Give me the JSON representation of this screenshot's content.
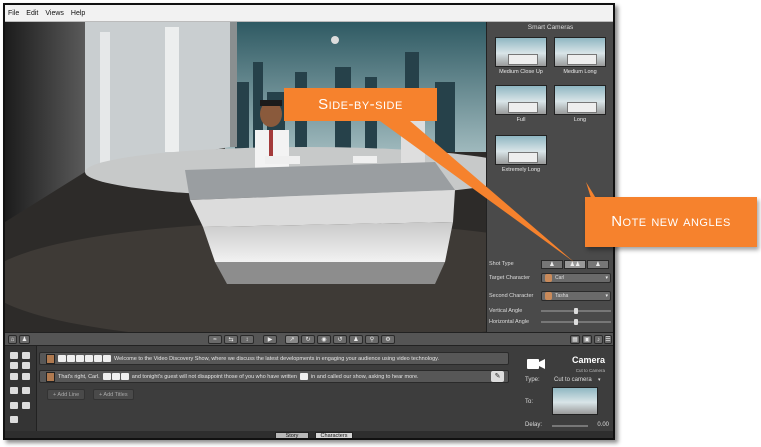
{
  "menu": [
    "File",
    "Edit",
    "Views",
    "Help"
  ],
  "side_panel": {
    "title": "Smart Cameras",
    "cameras": [
      {
        "label": "Medium Close Up"
      },
      {
        "label": "Medium Long"
      },
      {
        "label": "Full"
      },
      {
        "label": "Long"
      },
      {
        "label": "Extremely Long"
      }
    ],
    "shot_type_label": "Shot Type",
    "target_label": "Target Character",
    "target_value": "Carl",
    "second_label": "Second Character",
    "second_value": "Tasha",
    "vertical_angle_label": "Vertical Angle",
    "horizontal_angle_label": "Horizontal Angle",
    "vertical_angle_value": 0.5,
    "horizontal_angle_value": 0.5
  },
  "timeline": {
    "line1": "Welcome to the Video Discovery Show, where we discuss the latest developments in engaging your audience using video technology.",
    "line2_a": "That's right, Carl.",
    "line2_b": "and tonight's guest will not disappoint those of you who have written",
    "line2_c": "in and called our show, asking to hear more.",
    "add_line": "+ Add Line",
    "add_titles": "+ Add Titles"
  },
  "camera_panel": {
    "title": "Camera",
    "subtitle": "Cut to Camera",
    "type_label": "Type:",
    "type_value": "Cut to camera",
    "to_label": "To:",
    "delay_label": "Delay:",
    "delay_value": "0.00"
  },
  "bottom_tabs": [
    "Story",
    "Characters"
  ],
  "callouts": {
    "side_by_side": "Side-by-side",
    "note": "Note new angles"
  },
  "colors": {
    "callout": "#f6822d",
    "panel": "#4a4a4a",
    "timeline": "#3d3d3d"
  }
}
